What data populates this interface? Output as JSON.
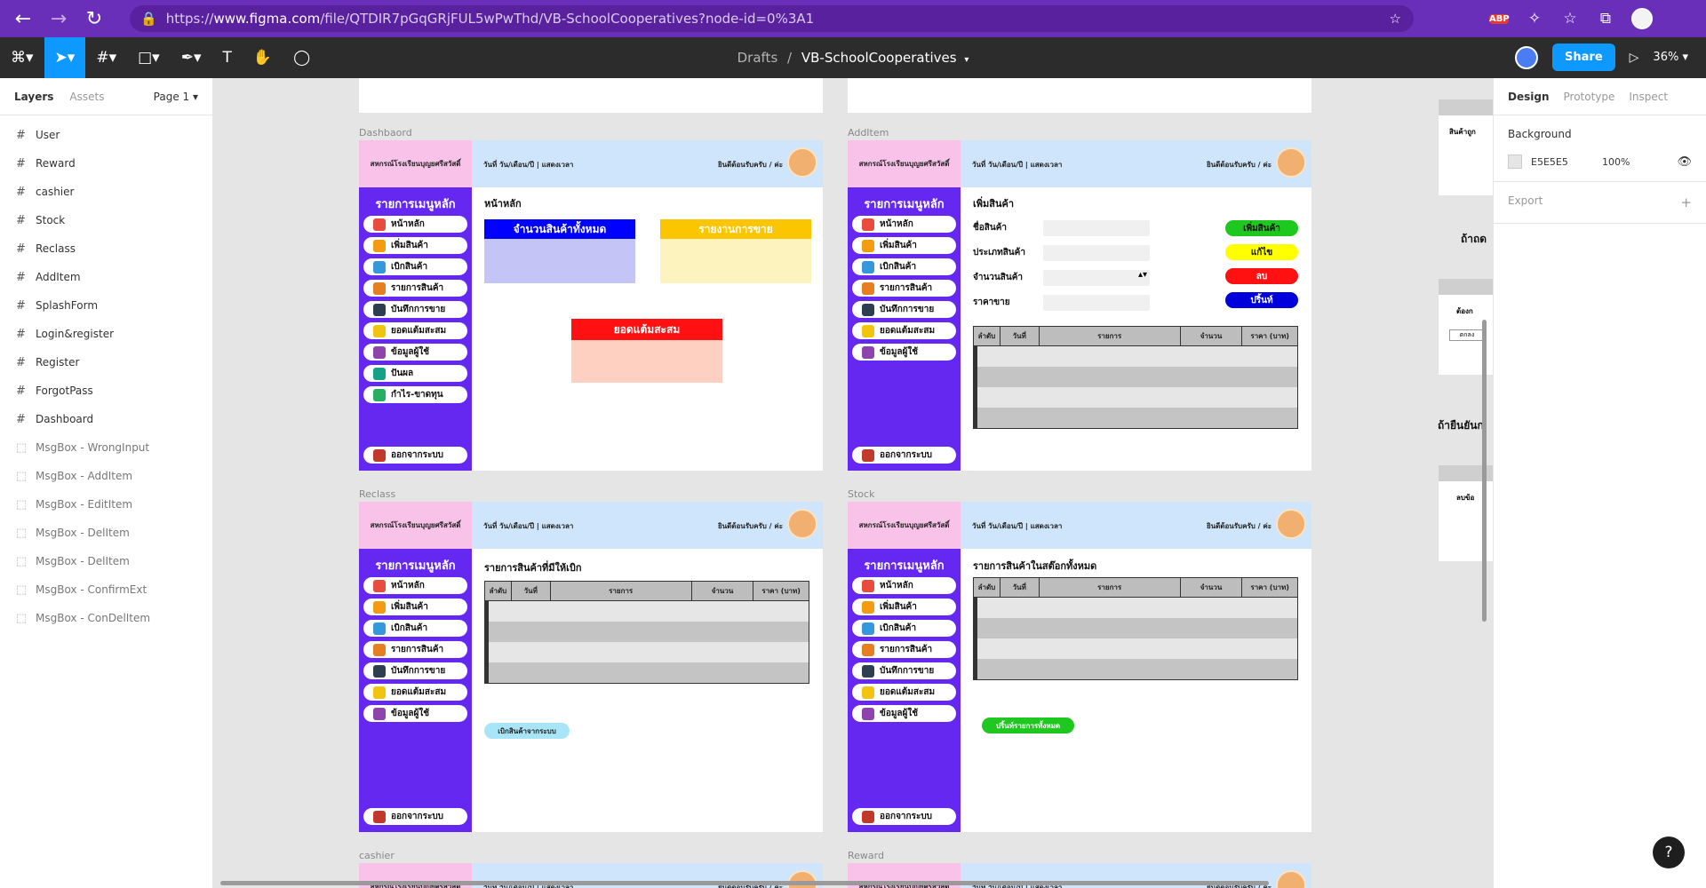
{
  "browser": {
    "url_prefix": "https://",
    "url_host": "www.figma.com",
    "url_path": "/file/QTDIR7pGqGRjFUL5wPwThd/VB-SchoolCooperatives?node-id=0%3A1",
    "abp_badge": "ABP"
  },
  "toolbar": {
    "breadcrumb_drafts": "Drafts",
    "breadcrumb_sep": "/",
    "file_name": "VB-SchoolCooperatives",
    "share_label": "Share",
    "zoom": "36%"
  },
  "left_panel": {
    "tab_layers": "Layers",
    "tab_assets": "Assets",
    "page": "Page 1",
    "layers": [
      {
        "name": "User",
        "type": "frame"
      },
      {
        "name": "Reward",
        "type": "frame"
      },
      {
        "name": "cashier",
        "type": "frame"
      },
      {
        "name": "Stock",
        "type": "frame"
      },
      {
        "name": "Reclass",
        "type": "frame"
      },
      {
        "name": "AddItem",
        "type": "frame"
      },
      {
        "name": "SplashForm",
        "type": "frame"
      },
      {
        "name": "Login&register",
        "type": "frame"
      },
      {
        "name": "Register",
        "type": "frame"
      },
      {
        "name": "ForgotPass",
        "type": "frame"
      },
      {
        "name": "Dashboard",
        "type": "frame"
      },
      {
        "name": "MsgBox - WrongInput",
        "type": "component"
      },
      {
        "name": "MsgBox - AddItem",
        "type": "component"
      },
      {
        "name": "MsgBox - EditItem",
        "type": "component"
      },
      {
        "name": "MsgBox - DelItem",
        "type": "component"
      },
      {
        "name": "MsgBox - DelItem",
        "type": "component"
      },
      {
        "name": "MsgBox - ConfirmExt",
        "type": "component"
      },
      {
        "name": "MsgBox - ConDelItem",
        "type": "component"
      }
    ]
  },
  "right_panel": {
    "tab_design": "Design",
    "tab_prototype": "Prototype",
    "tab_inspect": "Inspect",
    "background_label": "Background",
    "bg_hex": "E5E5E5",
    "bg_opacity": "100%",
    "export_label": "Export"
  },
  "canvas": {
    "frame_labels": [
      "Dashbaord",
      "AddItem",
      "Reclass",
      "Stock",
      "cashier",
      "Reward"
    ],
    "header": {
      "school": "สหกรณ์โรงเรียนบุญยศรีสวัสดิ์",
      "date": "วันที่ วัน/เดือน/ปี | แสดงเวลา",
      "welcome": "ยินดีต้อนรับครับ / ค่ะ"
    },
    "menu_title": "รายการเมนูหลัก",
    "menu": [
      "หน้าหลัก",
      "เพิ่มสินค้า",
      "เบิกสินค้า",
      "รายการสินค้า",
      "บันทึกการขาย",
      "ยอดแต้มสะสม",
      "ข้อมูลผู้ใช้",
      "ปันผล",
      "กำไร-ขาดทุน",
      "ออกจากระบบ"
    ],
    "dashboard": {
      "title": "หน้าหลัก",
      "card_total": "จำนวนสินค้าทั้งหมด",
      "card_sales": "รายงานการขาย",
      "card_points": "ยอดแต้มสะสม"
    },
    "additem": {
      "title": "เพิ่มสินค้า",
      "label_name": "ชื่อสินค้า",
      "label_type": "ประเภทสินค้า",
      "label_qty": "จำนวนสินค้า",
      "label_price": "ราคาขาย",
      "btn_add": "เพิ่มสินค้า",
      "btn_edit": "แก้ไข",
      "btn_delete": "ลบ",
      "btn_print": "ปริ้นท์"
    },
    "table_headers": [
      "ลำดับ",
      "วันที่",
      "รายการ",
      "จำนวน",
      "ราคา (บาท)"
    ],
    "reclass": {
      "title": "รายการสินค้าที่มีให้เบิก",
      "button": "เบิกสินค้าจากระบบ"
    },
    "stock": {
      "title": "รายการสินค้าในสต๊อกทั้งหมด",
      "button": "ปริ้นท์รายการทั้งหมด"
    },
    "peek_texts": [
      "สินค้าถูก",
      "ถ้าถด",
      "ต้องก",
      "ตกลง",
      "ถ้ายืนยันก",
      "ลบข้อ"
    ]
  }
}
